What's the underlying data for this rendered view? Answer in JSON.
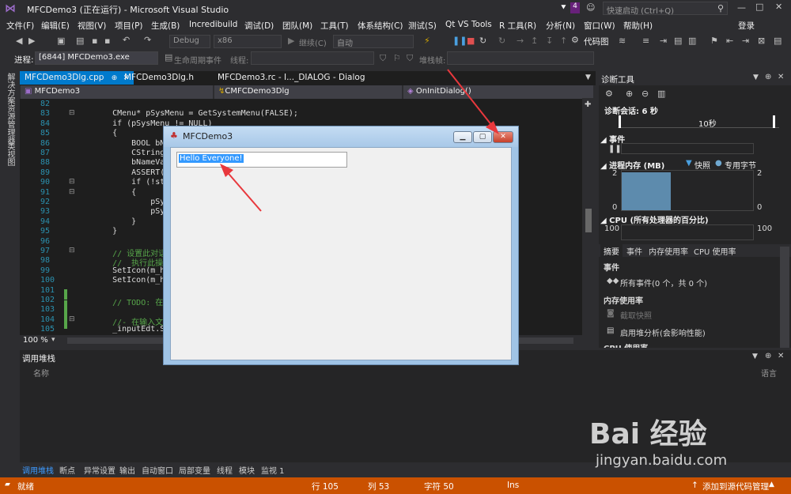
{
  "titlebar": {
    "title": "MFCDemo3 (正在运行) - Microsoft Visual Studio",
    "badge": "4",
    "quick_launch": "快速启动 (Ctrl+Q)"
  },
  "menu": [
    "文件(F)",
    "编辑(E)",
    "视图(V)",
    "项目(P)",
    "生成(B)",
    "Incredibuild",
    "调试(D)",
    "团队(M)",
    "工具(T)",
    "体系结构(C)",
    "测试(S)",
    "Qt VS Tools",
    "R 工具(R)",
    "分析(N)",
    "窗口(W)",
    "帮助(H)"
  ],
  "signin": "登录",
  "toolbar": {
    "config": "Debug",
    "platform": "x86",
    "continue": "继续(C)",
    "auto": "自动",
    "codemap": "代码图"
  },
  "procbar": {
    "label": "进程:",
    "process": "[6844] MFCDemo3.exe",
    "lifecycle": "生命周期事件",
    "thread_label": "线程:",
    "stackframe_label": "堆栈帧:"
  },
  "left_sidebar": [
    "解决方案资源管理器",
    "类视图"
  ],
  "tabs": [
    {
      "label": "MFCDemo3Dlg.cpp",
      "active": true
    },
    {
      "label": "MFCDemo3Dlg.h",
      "active": false
    },
    {
      "label": "MFCDemo3.rc - I..._DIALOG - Dialog",
      "active": false
    }
  ],
  "nav": {
    "project": "MFCDemo3",
    "class": "CMFCDemo3Dlg",
    "member": "OnInitDialog()"
  },
  "code": [
    {
      "n": "82",
      "t": ""
    },
    {
      "n": "83",
      "t": "    CMenu* pSysMenu = GetSystemMenu(FALSE);"
    },
    {
      "n": "84",
      "t": "    if (pSysMenu != NULL)"
    },
    {
      "n": "85",
      "t": "    {"
    },
    {
      "n": "86",
      "t": "        BOOL bNameVa"
    },
    {
      "n": "87",
      "t": "        CString strA"
    },
    {
      "n": "88",
      "t": "        bNameValid ="
    },
    {
      "n": "89",
      "t": "        ASSERT(bName"
    },
    {
      "n": "90",
      "t": "        if (!strAbou"
    },
    {
      "n": "91",
      "t": "        {"
    },
    {
      "n": "92",
      "t": "            pSysMenu"
    },
    {
      "n": "93",
      "t": "            pSysMenu"
    },
    {
      "n": "94",
      "t": "        }"
    },
    {
      "n": "95",
      "t": "    }"
    },
    {
      "n": "96",
      "t": ""
    },
    {
      "n": "97",
      "t": "    // 设置此对话框的"
    },
    {
      "n": "98",
      "t": "    //  执行此操作"
    },
    {
      "n": "99",
      "t": "    SetIcon(m_hIcon,"
    },
    {
      "n": "100",
      "t": "    SetIcon(m_hIcon,"
    },
    {
      "n": "101",
      "t": ""
    },
    {
      "n": "102",
      "t": "    // TODO: 在此添加"
    },
    {
      "n": "103",
      "t": ""
    },
    {
      "n": "104",
      "t": "    //- 在输入文本框"
    },
    {
      "n": "105",
      "t": "    _inputEdt.SetWin"
    }
  ],
  "zoom": "100 %",
  "diagnostics": {
    "title": "诊断工具",
    "session": "诊断会话: 6 秒",
    "timeline_label": "10秒",
    "events_label": "事件",
    "memory_label": "进程内存 (MB)",
    "snapshot_legend": "快照",
    "private_legend": "专用字节",
    "mem_max": "2",
    "mem_min": "0",
    "cpu_label": "CPU (所有处理器的百分比)",
    "cpu_max": "100",
    "tabs": [
      "摘要",
      "事件",
      "内存使用率",
      "CPU 使用率"
    ],
    "summary_events_header": "事件",
    "all_events": "所有事件(0 个，共 0 个)",
    "memory_header": "内存使用率",
    "snapshot_btn": "截取快照",
    "heap_btn": "启用堆分析(会影响性能)",
    "cpu_header": "CPU 使用率"
  },
  "callstack": {
    "title": "调用堆栈",
    "col_name": "名称",
    "col_lang": "语言"
  },
  "bottom_tabs": [
    "调用堆栈",
    "断点",
    "异常设置",
    "输出",
    "自动窗口",
    "局部变量",
    "线程",
    "模块",
    "监视 1"
  ],
  "status": {
    "ready": "就绪",
    "line": "行 105",
    "col": "列 53",
    "char": "字符 50",
    "ins": "Ins",
    "source_control": "添加到源代码管理"
  },
  "dialog": {
    "title": "MFCDemo3",
    "edit_value": "Hello Everyone!"
  },
  "watermark": {
    "brand": "Bai 经验",
    "url": "jingyan.baidu.com"
  },
  "colors": {
    "accent": "#007acc",
    "status": "#ca5100",
    "arrow": "#e8383d"
  }
}
